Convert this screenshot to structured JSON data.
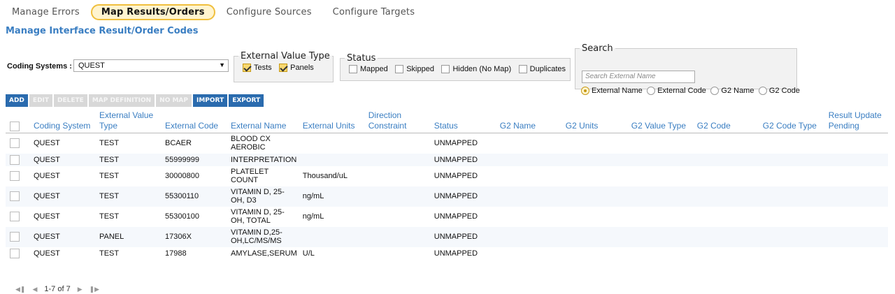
{
  "tabs": [
    "Manage Errors",
    "Map Results/Orders",
    "Configure Sources",
    "Configure Targets"
  ],
  "page_title": "Manage Interface Result/Order Codes",
  "coding_systems": {
    "label": "Coding Systems :",
    "value": "QUEST"
  },
  "external_value_type": {
    "legend": "External Value Type",
    "options": [
      {
        "label": "Tests",
        "checked": true
      },
      {
        "label": "Panels",
        "checked": true
      }
    ]
  },
  "status_filter": {
    "legend": "Status",
    "options": [
      {
        "label": "Mapped"
      },
      {
        "label": "Skipped"
      },
      {
        "label": "Hidden (No Map)"
      },
      {
        "label": "Duplicates"
      }
    ]
  },
  "search": {
    "legend": "Search",
    "placeholder": "Search External Name",
    "options": [
      "External Name",
      "External Code",
      "G2 Name",
      "G2 Code"
    ],
    "selected": "External Name"
  },
  "toolbar": {
    "add": "ADD",
    "edit": "EDIT",
    "delete": "DELETE",
    "map_definition": "MAP DEFINITION",
    "no_map": "NO MAP",
    "import": "IMPORT",
    "export": "EXPORT"
  },
  "columns": [
    "Coding System",
    "External Value Type",
    "External Code",
    "External Name",
    "External Units",
    "Direction Constraint",
    "Status",
    "G2 Name",
    "G2 Units",
    "G2 Value Type",
    "G2 Code",
    "G2 Code Type",
    "Result Update Pending"
  ],
  "rows": [
    {
      "coding_system": "QUEST",
      "value_type": "TEST",
      "code": "BCAER",
      "name": "BLOOD CX AEROBIC",
      "units": "",
      "status": "UNMAPPED"
    },
    {
      "coding_system": "QUEST",
      "value_type": "TEST",
      "code": "55999999",
      "name": "INTERPRETATION",
      "units": "",
      "status": "UNMAPPED"
    },
    {
      "coding_system": "QUEST",
      "value_type": "TEST",
      "code": "30000800",
      "name": "PLATELET COUNT",
      "units": "Thousand/uL",
      "status": "UNMAPPED"
    },
    {
      "coding_system": "QUEST",
      "value_type": "TEST",
      "code": "55300110",
      "name": "VITAMIN D, 25-OH, D3",
      "units": "ng/mL",
      "status": "UNMAPPED"
    },
    {
      "coding_system": "QUEST",
      "value_type": "TEST",
      "code": "55300100",
      "name": "VITAMIN D, 25-OH, TOTAL",
      "units": "ng/mL",
      "status": "UNMAPPED"
    },
    {
      "coding_system": "QUEST",
      "value_type": "PANEL",
      "code": "17306X",
      "name": "VITAMIN D,25-OH,LC/MS/MS",
      "units": "",
      "status": "UNMAPPED"
    },
    {
      "coding_system": "QUEST",
      "value_type": "TEST",
      "code": "17988",
      "name": "AMYLASE,SERUM",
      "units": "U/L",
      "status": "UNMAPPED"
    }
  ],
  "pager": {
    "text": "1-7 of 7"
  },
  "colors": {
    "accent": "#3a7ec2",
    "active_tab_border": "#f0bf3d",
    "button": "#2a6bae"
  }
}
